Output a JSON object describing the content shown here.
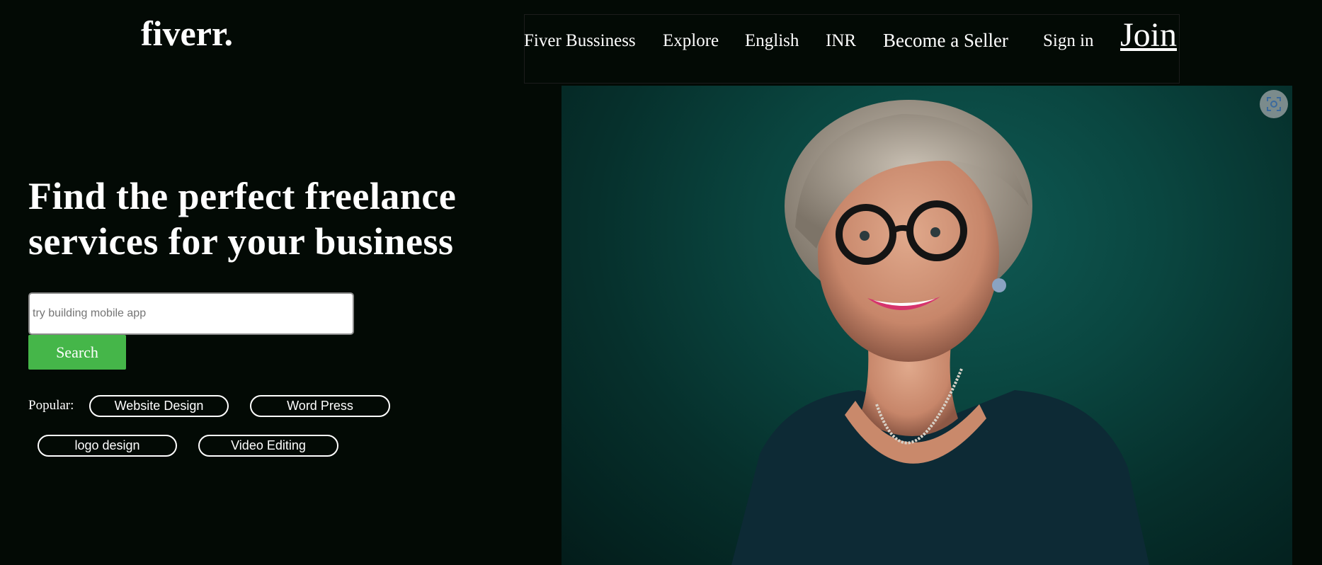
{
  "logo": {
    "text": "fiverr."
  },
  "nav": {
    "items": [
      "Fiver Bussiness",
      "Explore",
      "English",
      "INR",
      "Become a Seller",
      "Sign in"
    ],
    "join": "Join"
  },
  "hero": {
    "title_line1": "Find the perfect freelance",
    "title_line2": "services for your business",
    "search": {
      "placeholder": "try building mobile app",
      "value": "",
      "button": "Search"
    },
    "popular": {
      "label": "Popular:",
      "tags": [
        "Website Design",
        "Word Press",
        "logo design",
        "Video Editing"
      ]
    }
  },
  "icons": {
    "lens": "visual-search-icon"
  },
  "colors": {
    "background": "#030a05",
    "accent": "#45b649",
    "text": "#ffffff"
  }
}
